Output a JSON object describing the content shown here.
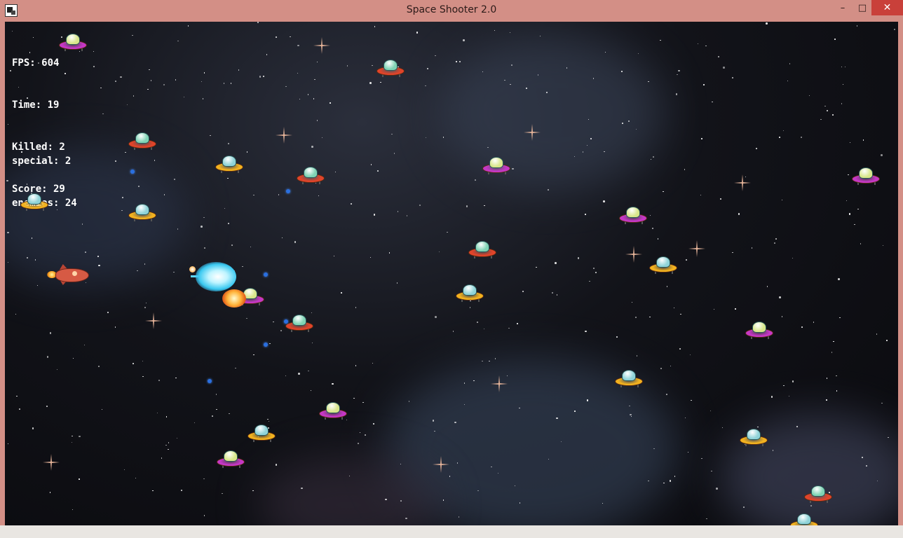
{
  "window": {
    "title": "Space Shooter 2.0",
    "minimize_glyph": "–",
    "maximize_glyph": "□",
    "close_glyph": "✕"
  },
  "hud": {
    "fps": "FPS: 604",
    "time": "Time: 19",
    "killed": "Killed: 2",
    "score": "Score: 29",
    "special": "special: 2",
    "enemies": "enemies: 24"
  },
  "colors": {
    "titlebar": "#d38f86",
    "close_button": "#c9403a",
    "hud_text": "#ffffff",
    "bullet": "#2a6fe0",
    "ufo_variants": {
      "gold": {
        "saucer": "#f2b21f",
        "dome": "#8fd3d8"
      },
      "red": {
        "saucer": "#e0442a",
        "dome": "#7fd3b4"
      },
      "purple": {
        "saucer": "#c637c6",
        "dome": "#d8e68a"
      }
    }
  },
  "icons": {
    "app": "app-icon",
    "player": "rocket-ship-icon",
    "enemy": "ufo-icon",
    "bullet": "plasma-bullet-icon",
    "blast": "energy-blast-icon",
    "explosion": "explosion-icon"
  }
}
